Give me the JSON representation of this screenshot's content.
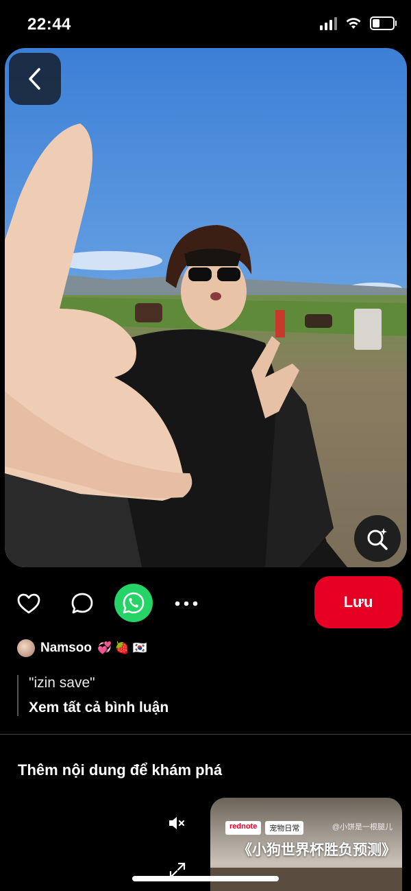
{
  "status_bar": {
    "time": "22:44"
  },
  "pin": {
    "image_description_icon": "pin-photo"
  },
  "actions": {
    "save_label": "Lưu",
    "icons": [
      "heart-icon",
      "comment-icon",
      "whatsapp-icon",
      "more-icon"
    ]
  },
  "author": {
    "name": "Namsoo",
    "emojis": "💞 🍓 🇰🇷"
  },
  "comment": {
    "text": "\"izin save\"",
    "see_all": "Xem tất cả bình luận"
  },
  "explore": {
    "title": "Thêm nội dung để khám phá"
  },
  "video_card": {
    "brand": "rednote",
    "tag": "宠物日常",
    "user": "@小饼是一根腿儿",
    "title": "《小狗世界杯胜负预测》"
  },
  "colors": {
    "save": "#e60023",
    "whatsapp": "#25d366",
    "background": "#000000"
  }
}
